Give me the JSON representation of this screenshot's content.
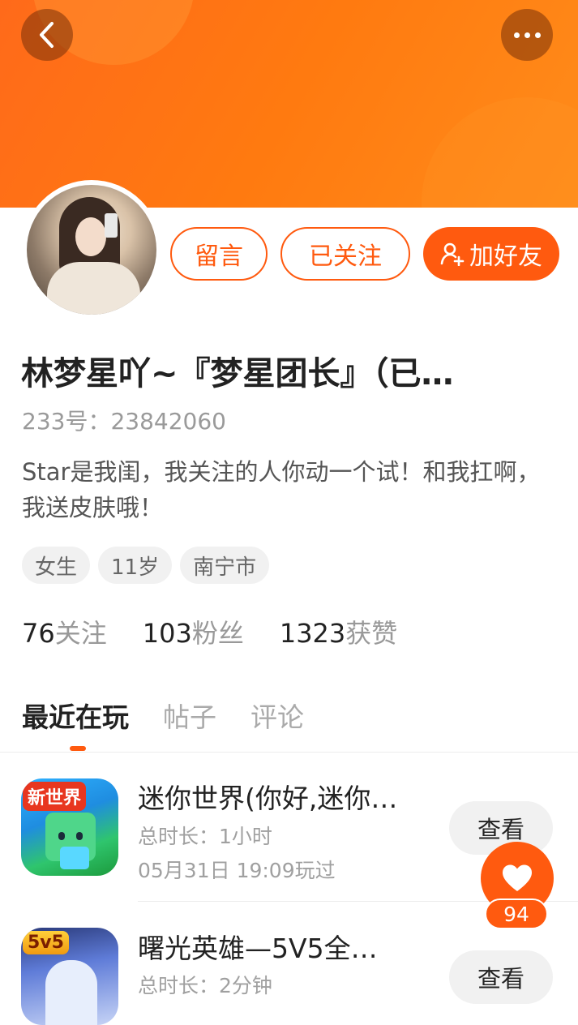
{
  "header": {
    "accent_color": "#ff6a1a"
  },
  "actions": {
    "message_label": "留言",
    "follow_label": "已关注",
    "add_friend_label": "加好友"
  },
  "profile": {
    "name": " 林梦星吖~『梦星团长』（已…",
    "id_text": "233号：23842060",
    "bio": "Star是我闺，我关注的人你动一个试！和我扛啊，我送皮肤哦！",
    "tags": [
      "女生",
      "11岁",
      "南宁市"
    ]
  },
  "stats": [
    {
      "num": "76",
      "label": "关注"
    },
    {
      "num": "103",
      "label": "粉丝"
    },
    {
      "num": "1323",
      "label": "获赞"
    }
  ],
  "tabs": [
    "最近在玩",
    "帖子",
    "评论"
  ],
  "games": [
    {
      "title": "迷你世界(你好,迷你…",
      "duration": "总时长：1小时",
      "last_played": "05月31日 19:09玩过",
      "badge": "新世界",
      "button": "查看"
    },
    {
      "title": "曙光英雄—5V5全…",
      "duration": "总时长：2分钟",
      "badge": "5v5",
      "button": "查看"
    }
  ],
  "like": {
    "count": "94"
  }
}
